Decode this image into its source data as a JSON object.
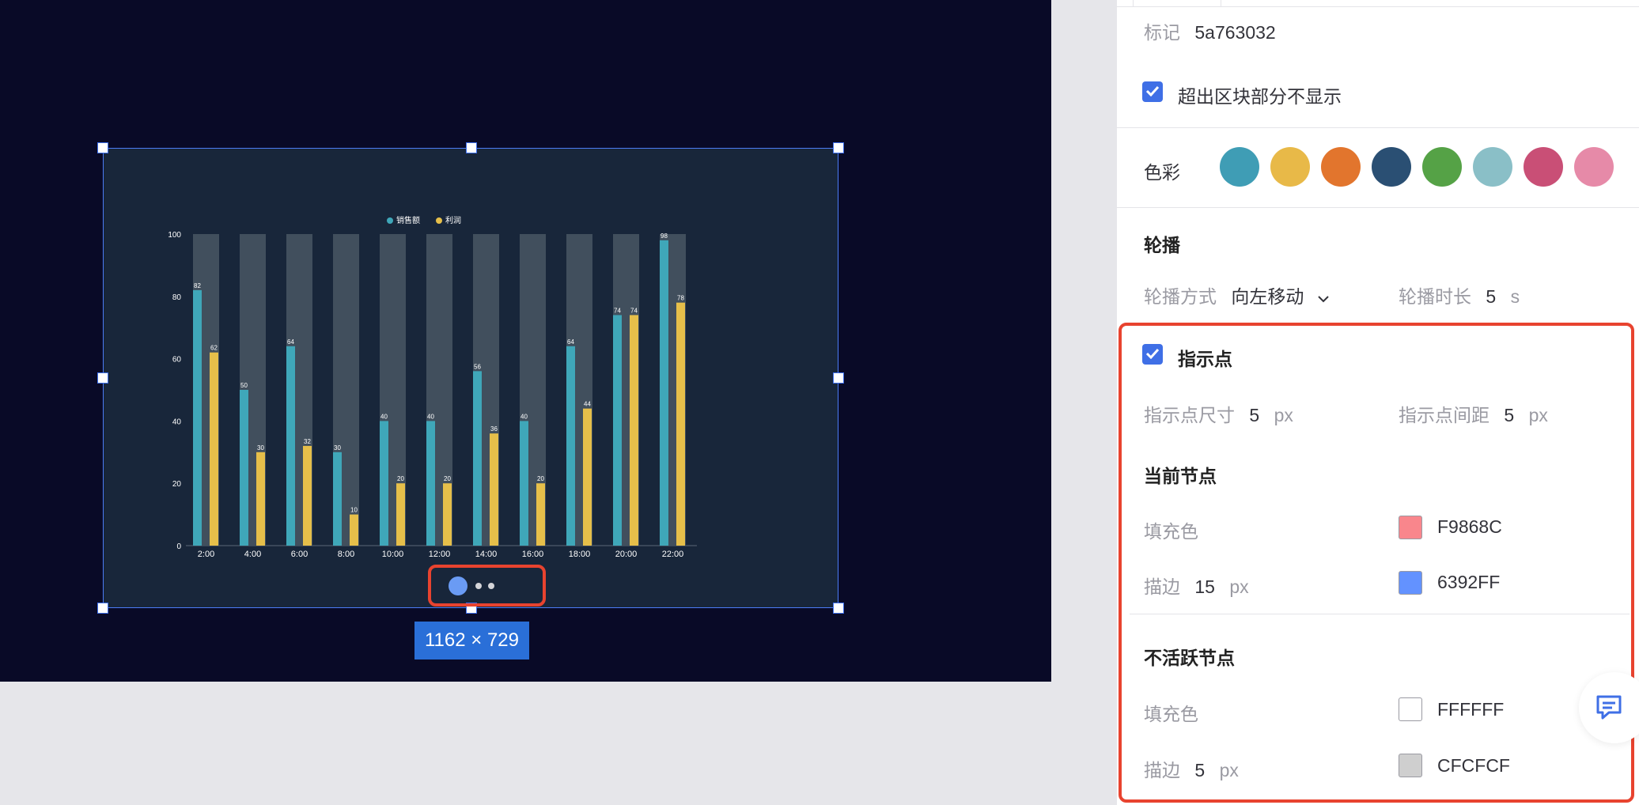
{
  "canvas": {
    "size_label": "1162 × 729"
  },
  "chart_data": {
    "type": "bar",
    "categories": [
      "2:00",
      "4:00",
      "6:00",
      "8:00",
      "10:00",
      "12:00",
      "14:00",
      "16:00",
      "18:00",
      "20:00",
      "22:00"
    ],
    "series": [
      {
        "name": "销售额",
        "color": "#3fa7b9",
        "values": [
          82,
          50,
          64,
          30,
          40,
          40,
          56,
          40,
          64,
          74,
          98
        ]
      },
      {
        "name": "利润",
        "color": "#e6bf4a",
        "values": [
          62,
          30,
          32,
          10,
          20,
          20,
          36,
          20,
          44,
          74,
          78
        ]
      }
    ],
    "background_bar_max": 100,
    "ylim": [
      0,
      100
    ],
    "yticks": [
      0,
      20,
      40,
      60,
      80,
      100
    ],
    "legend_position": "top-center",
    "carousel_dots": 3,
    "carousel_active_index": 0
  },
  "panel": {
    "tag_label": "标记",
    "tag_value": "5a763032",
    "hide_overflow_label": "超出区块部分不显示",
    "color_label": "色彩",
    "palette": [
      "#3f9db5",
      "#e8b948",
      "#e2752d",
      "#2a4f73",
      "#55a246",
      "#8abfc7",
      "#c94f76",
      "#e68aa8"
    ],
    "carousel_section": "轮播",
    "carousel_mode_label": "轮播方式",
    "carousel_mode_value": "向左移动",
    "carousel_duration_label": "轮播时长",
    "carousel_duration_value": "5",
    "carousel_duration_unit": "s",
    "indicator_label": "指示点",
    "indicator_size_label": "指示点尺寸",
    "indicator_size_value": "5",
    "indicator_size_unit": "px",
    "indicator_gap_label": "指示点间距",
    "indicator_gap_value": "5",
    "indicator_gap_unit": "px",
    "current_node_section": "当前节点",
    "current_fill_label": "填充色",
    "current_fill_color": "F9868C",
    "current_fill_hex": "#F9868C",
    "current_stroke_label": "描边",
    "current_stroke_value": "15",
    "current_stroke_unit": "px",
    "current_stroke_color": "6392FF",
    "current_stroke_hex": "#6392FF",
    "inactive_node_section": "不活跃节点",
    "inactive_fill_label": "填充色",
    "inactive_fill_color": "FFFFFF",
    "inactive_fill_hex": "#FFFFFF",
    "inactive_stroke_label": "描边",
    "inactive_stroke_value": "5",
    "inactive_stroke_unit": "px",
    "inactive_stroke_color": "CFCFCF",
    "inactive_stroke_hex": "#CFCFCF"
  }
}
